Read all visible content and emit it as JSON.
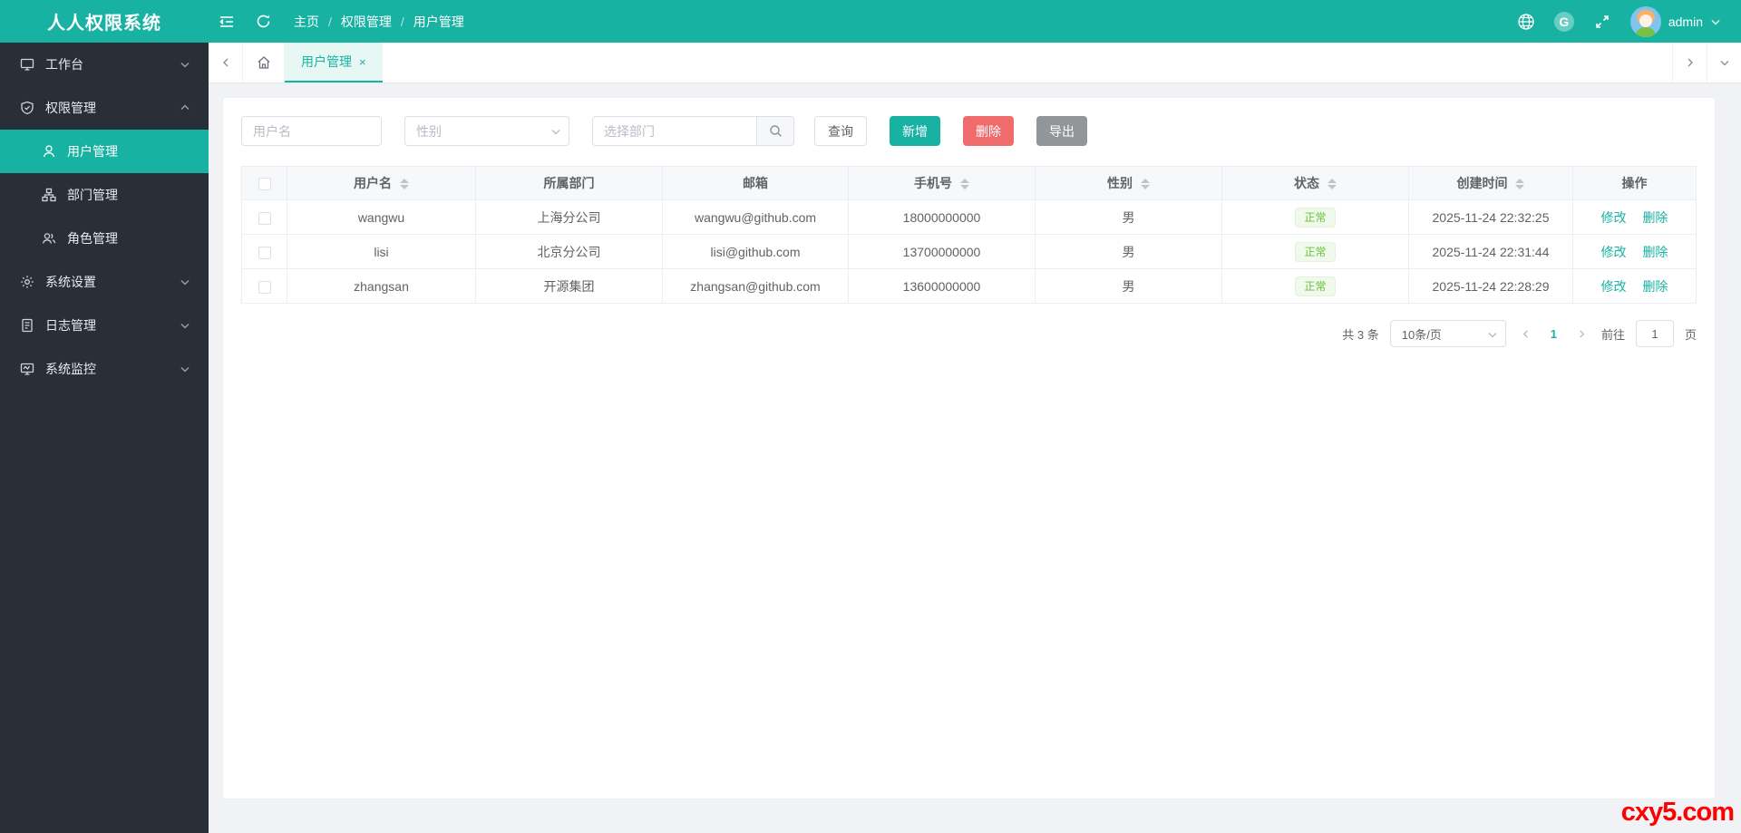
{
  "header": {
    "logo": "人人权限系统",
    "breadcrumb": {
      "home": "主页",
      "section": "权限管理",
      "page": "用户管理",
      "separator": "/"
    },
    "user": "admin"
  },
  "sidebar": {
    "items": [
      {
        "label": "工作台"
      },
      {
        "label": "权限管理"
      },
      {
        "label": "用户管理"
      },
      {
        "label": "部门管理"
      },
      {
        "label": "角色管理"
      },
      {
        "label": "系统设置"
      },
      {
        "label": "日志管理"
      },
      {
        "label": "系统监控"
      }
    ]
  },
  "tabs": {
    "active": "用户管理",
    "close": "×"
  },
  "filters": {
    "username_placeholder": "用户名",
    "gender_placeholder": "性别",
    "dept_placeholder": "选择部门",
    "query_label": "查询",
    "add_label": "新增",
    "delete_label": "删除",
    "export_label": "导出"
  },
  "table": {
    "headers": {
      "username": "用户名",
      "dept": "所属部门",
      "email": "邮箱",
      "phone": "手机号",
      "gender": "性别",
      "status": "状态",
      "created": "创建时间",
      "ops": "操作"
    },
    "rows": [
      {
        "username": "wangwu",
        "dept": "上海分公司",
        "email": "wangwu@github.com",
        "phone": "18000000000",
        "gender": "男",
        "status": "正常",
        "created": "2025-11-24 22:32:25",
        "edit": "修改",
        "del": "删除"
      },
      {
        "username": "lisi",
        "dept": "北京分公司",
        "email": "lisi@github.com",
        "phone": "13700000000",
        "gender": "男",
        "status": "正常",
        "created": "2025-11-24 22:31:44",
        "edit": "修改",
        "del": "删除"
      },
      {
        "username": "zhangsan",
        "dept": "开源集团",
        "email": "zhangsan@github.com",
        "phone": "13600000000",
        "gender": "男",
        "status": "正常",
        "created": "2025-11-24 22:28:29",
        "edit": "修改",
        "del": "删除"
      }
    ]
  },
  "pagination": {
    "total": "共 3 条",
    "page_size": "10条/页",
    "current_page": "1",
    "goto_label": "前往",
    "goto_value": "1",
    "page_unit": "页"
  },
  "watermark": "cxy5.com",
  "colors": {
    "accent": "#17b2a2",
    "danger": "#f06b6b",
    "info": "#939699",
    "success": "#67c23a",
    "sidebar_bg": "#282f37"
  }
}
